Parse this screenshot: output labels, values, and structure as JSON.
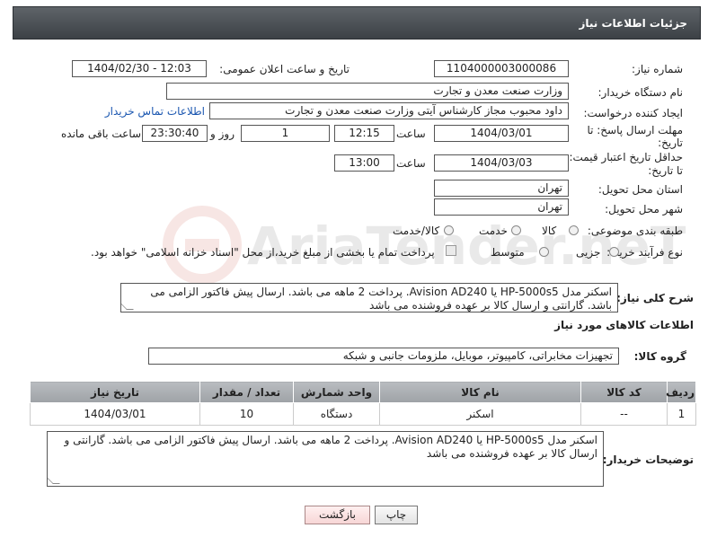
{
  "header": {
    "title": "جزئیات اطلاعات نیاز"
  },
  "fields": {
    "need_number": {
      "label": "شماره نیاز:",
      "value": "1104000003000086"
    },
    "announce_datetime": {
      "label": "تاریخ و ساعت اعلان عمومی:",
      "value": "1404/02/30 - 12:03"
    },
    "buyer_org": {
      "label": "نام دستگاه خریدار:",
      "value": "وزارت صنعت معدن و تجارت"
    },
    "requester": {
      "label": "ایجاد کننده درخواست:",
      "value": "داود محبوب مجاز کارشناس آیتی وزارت صنعت معدن و تجارت",
      "contact_link": "اطلاعات تماس خریدار"
    },
    "reply_deadline": {
      "label_line1": "مهلت ارسال پاسخ: تا",
      "label_line2": "تاریخ:",
      "date": "1404/03/01",
      "time_label": "ساعت",
      "time": "12:15",
      "days": "1",
      "days_label": "روز و",
      "remaining": "23:30:40",
      "remaining_label": "ساعت باقی مانده"
    },
    "price_validity": {
      "label_line1": "حداقل تاریخ اعتبار قیمت:",
      "label_line2": "تا تاریخ:",
      "date": "1404/03/03",
      "time_label": "ساعت",
      "time": "13:00"
    },
    "delivery_province": {
      "label": "استان محل تحویل:",
      "value": "تهران"
    },
    "delivery_city": {
      "label": "شهر محل تحویل:",
      "value": "تهران"
    },
    "category": {
      "label": "طبقه بندی موضوعی:",
      "options": [
        "کالا",
        "خدمت",
        "کالا/خدمت"
      ]
    },
    "process_type": {
      "label": "نوع فرآیند خرید :",
      "options": [
        "جزیی",
        "متوسط"
      ],
      "payment_note": "پرداخت تمام یا بخشی از مبلغ خرید،از محل \"اسناد خزانه اسلامی\" خواهد بود."
    }
  },
  "description": {
    "label": "شرح کلی نیاز:",
    "text": "اسکنر مدل HP-5000s5  یا Avision AD240. پرداخت 2 ماهه می باشد. ارسال پیش فاکتور الزامی می باشد. گارانتی و ارسال کالا بر عهده فروشنده می باشد"
  },
  "goods_info": {
    "title": "اطلاعات کالاهای مورد نیاز",
    "group_label": "گروه کالا:",
    "group_value": "تجهیزات مخابراتی، کامپیوتر، موبایل، ملزومات جانبی و شبکه",
    "columns": [
      "ردیف",
      "کد کالا",
      "نام کالا",
      "واحد شمارش",
      "تعداد / مقدار",
      "تاریخ نیاز"
    ],
    "rows": [
      {
        "row": "1",
        "code": "--",
        "name": "اسکنر",
        "unit": "دستگاه",
        "qty": "10",
        "date": "1404/03/01"
      }
    ]
  },
  "buyer_notes": {
    "label": "توضیحات خریدار:",
    "text": "اسکنر مدل HP-5000s5  یا Avision AD240. پرداخت 2 ماهه می باشد. ارسال پیش فاکتور الزامی می باشد. گارانتی و ارسال کالا بر عهده فروشنده می باشد"
  },
  "buttons": {
    "print": "چاپ",
    "back": "بازگشت"
  },
  "watermark": {
    "text": "AriaTender.neT"
  }
}
